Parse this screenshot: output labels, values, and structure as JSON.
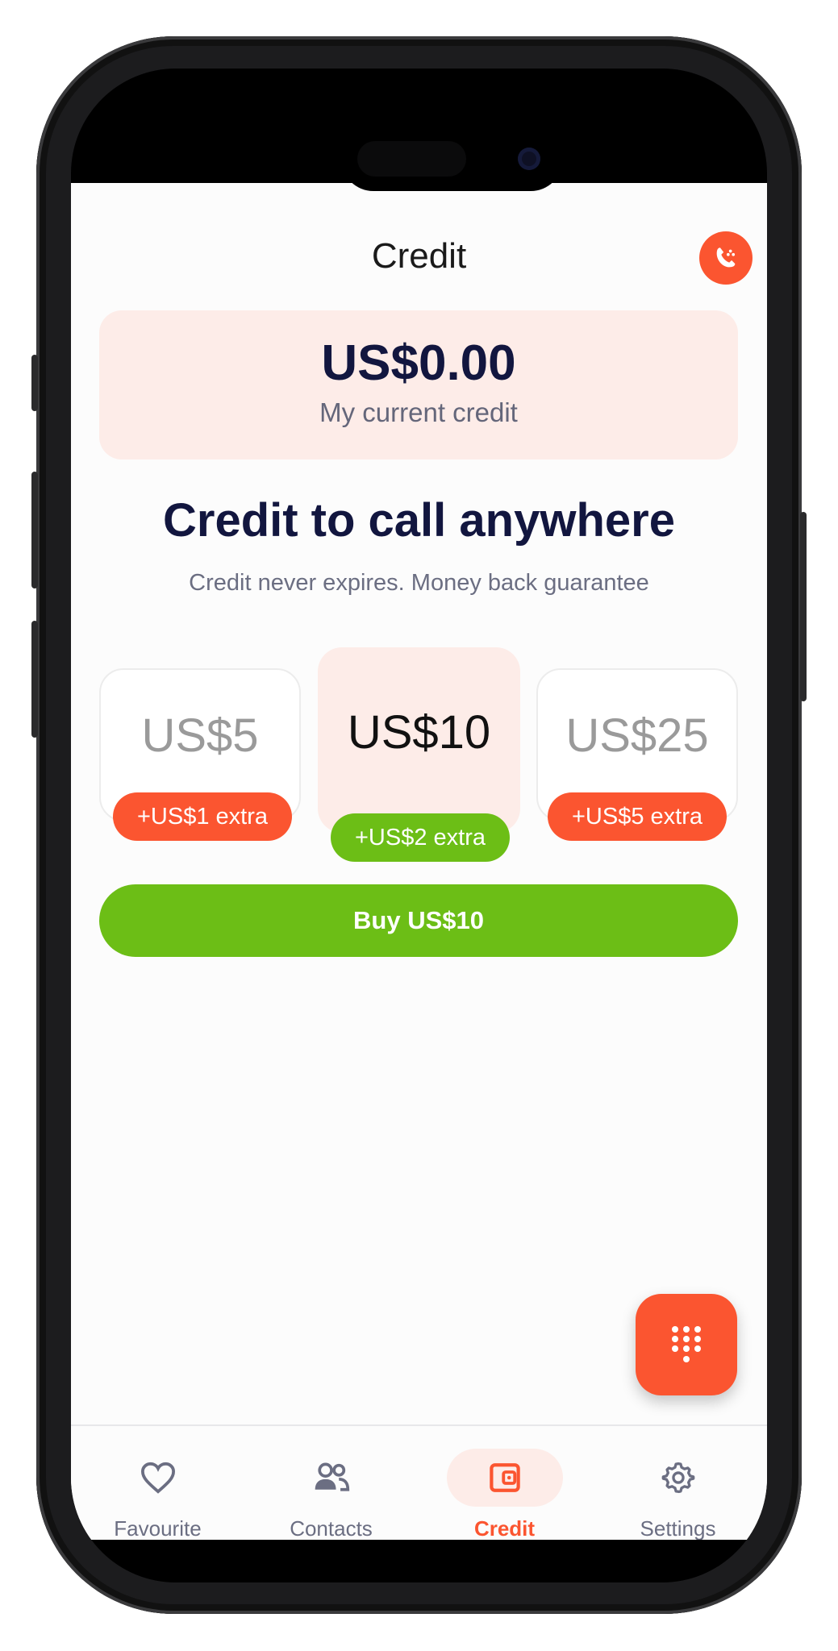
{
  "header": {
    "title": "Credit"
  },
  "balance": {
    "amount": "US$0.00",
    "label": "My current credit"
  },
  "promo": {
    "headline": "Credit to call anywhere",
    "subline": "Credit never expires. Money back guarantee"
  },
  "options": [
    {
      "value": "US$5",
      "badge": "+US$1 extra",
      "selected": false
    },
    {
      "value": "US$10",
      "badge": "+US$2 extra",
      "selected": true
    },
    {
      "value": "US$25",
      "badge": "+US$5 extra",
      "selected": false
    }
  ],
  "buy_button": {
    "label": "Buy US$10"
  },
  "nav": [
    {
      "label": "Favourite",
      "icon": "heart-icon",
      "active": false
    },
    {
      "label": "Contacts",
      "icon": "contacts-icon",
      "active": false
    },
    {
      "label": "Credit",
      "icon": "wallet-icon",
      "active": true
    },
    {
      "label": "Settings",
      "icon": "gear-icon",
      "active": false
    }
  ],
  "colors": {
    "accent": "#fb5530",
    "green": "#6cbe16",
    "tint": "#fdece8",
    "navy": "#12163f"
  }
}
